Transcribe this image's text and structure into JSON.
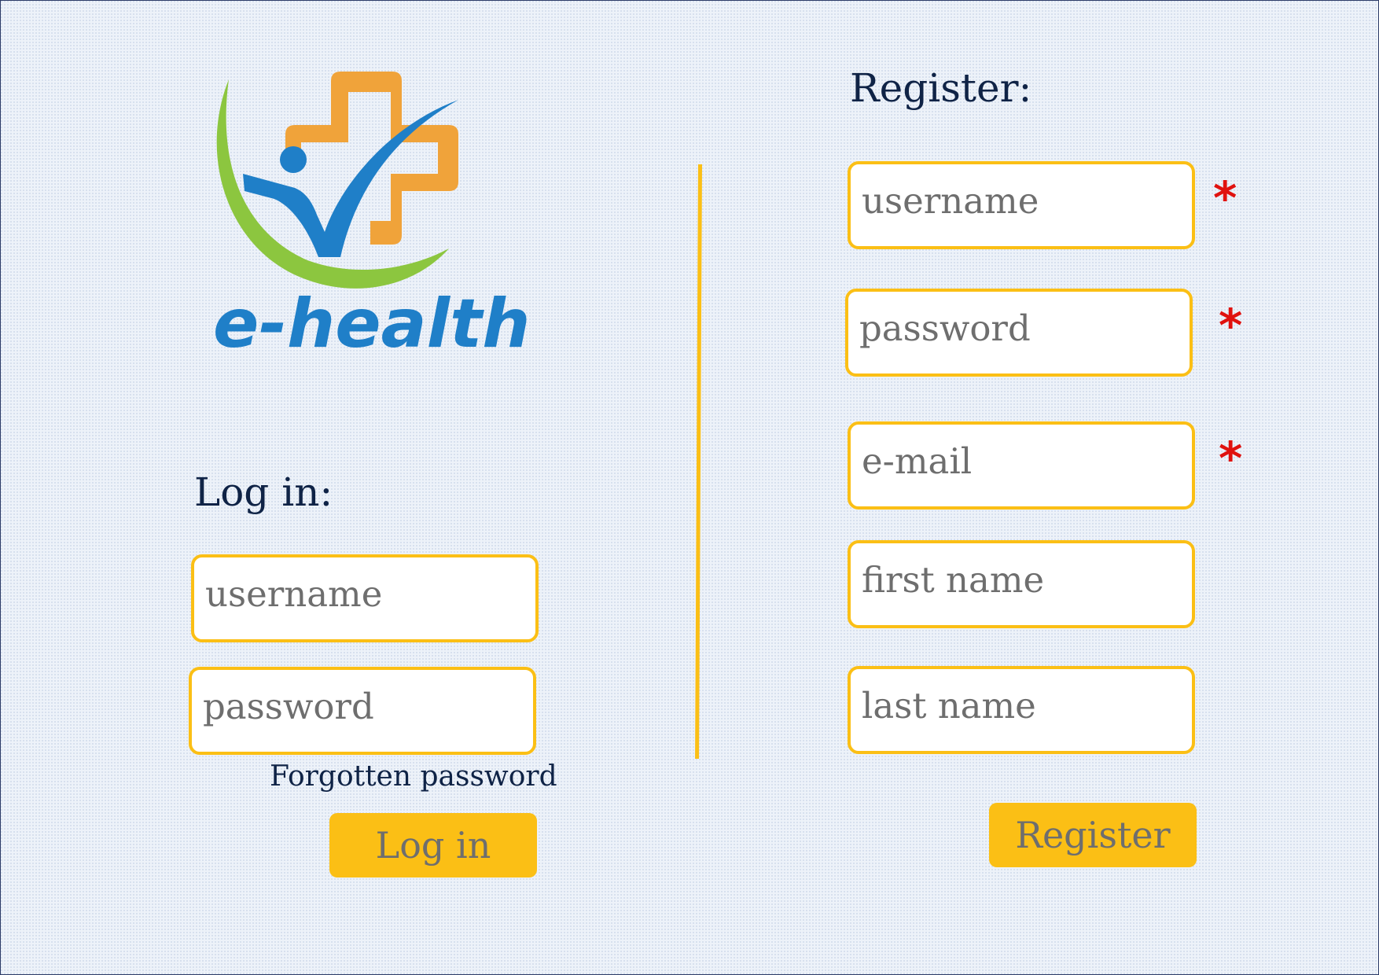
{
  "logo": {
    "wordmark": "e-health",
    "icon": "medical-cross-person-icon",
    "colors": {
      "cross": "#f0a33a",
      "figure": "#1f7fc8",
      "arc": "#8cc63f",
      "wordmark": "#1f7fc8"
    }
  },
  "login": {
    "heading": "Log in:",
    "username_placeholder": "username",
    "password_placeholder": "password",
    "forgot_label": "Forgotten password",
    "button_label": "Log in"
  },
  "register": {
    "heading": "Register:",
    "fields": [
      {
        "placeholder": "username",
        "required": true
      },
      {
        "placeholder": "password",
        "required": true
      },
      {
        "placeholder": "e-mail",
        "required": true
      },
      {
        "placeholder": "first name",
        "required": false
      },
      {
        "placeholder": "last name",
        "required": false
      }
    ],
    "required_marker": "*",
    "button_label": "Register"
  },
  "colors": {
    "accent": "#fbbf15",
    "required": "#e0120f",
    "heading": "#0f2346",
    "placeholder": "#6e6e6e",
    "background": "#edf2f9"
  }
}
